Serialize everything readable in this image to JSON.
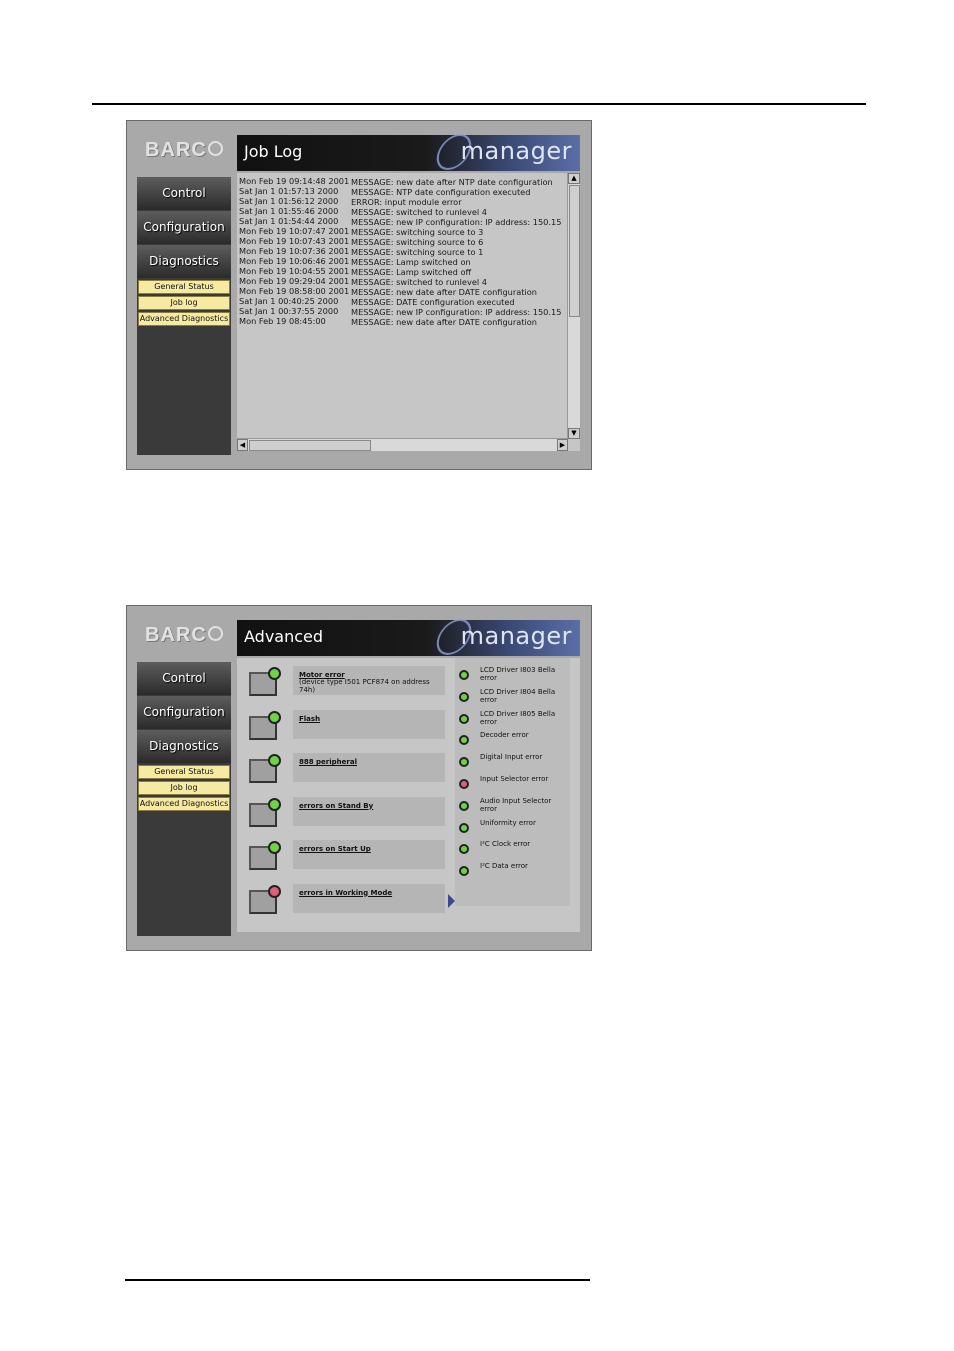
{
  "brand": {
    "logo": "BARC",
    "product": "manager"
  },
  "sidebar": {
    "nav": [
      "Control",
      "Configuration",
      "Diagnostics"
    ],
    "subnav": [
      "General Status",
      "Job log",
      "Advanced Diagnostics"
    ]
  },
  "joblog": {
    "title": "Job Log",
    "rows": [
      {
        "date": "Mon Feb 19 09:14:48 2001",
        "msg": "MESSAGE: new date after NTP date configuration"
      },
      {
        "date": "Sat Jan 1 01:57:13 2000",
        "msg": "MESSAGE: NTP date configuration executed"
      },
      {
        "date": "Sat Jan 1 01:56:12 2000",
        "msg": "ERROR: input module error"
      },
      {
        "date": "Sat Jan 1 01:55:46 2000",
        "msg": "MESSAGE: switched to runlevel 4"
      },
      {
        "date": "Sat Jan 1 01:54:44 2000",
        "msg": "MESSAGE: new IP configuration: IP address: 150.15"
      },
      {
        "date": "Mon Feb 19 10:07:47 2001",
        "msg": "MESSAGE: switching source to 3"
      },
      {
        "date": "Mon Feb 19 10:07:43 2001",
        "msg": "MESSAGE: switching source to 6"
      },
      {
        "date": "Mon Feb 19 10:07:36 2001",
        "msg": "MESSAGE: switching source to 1"
      },
      {
        "date": "Mon Feb 19 10:06:46 2001",
        "msg": "MESSAGE: Lamp switched on"
      },
      {
        "date": "Mon Feb 19 10:04:55 2001",
        "msg": "MESSAGE: Lamp switched off"
      },
      {
        "date": "Mon Feb 19 09:29:04 2001",
        "msg": "MESSAGE: switched to runlevel 4"
      },
      {
        "date": "Mon Feb 19 08:58:00 2001",
        "msg": "MESSAGE: new date after DATE configuration"
      },
      {
        "date": "Sat Jan 1 00:40:25 2000",
        "msg": "MESSAGE: DATE configuration executed"
      },
      {
        "date": "Sat Jan 1 00:37:55 2000",
        "msg": "MESSAGE: new IP configuration: IP address: 150.15"
      },
      {
        "date": "Mon Feb 19 08:45:00",
        "msg": "MESSAGE: new date after DATE configuration"
      }
    ]
  },
  "advanced": {
    "title": "Advanced",
    "items": [
      {
        "label": "Motor error",
        "sub": "(device type I501 PCF874 on address 74h)",
        "led": "#6fd34a"
      },
      {
        "label": "Flash",
        "sub": "",
        "led": "#6fd34a"
      },
      {
        "label": "888 peripheral",
        "sub": "",
        "led": "#6fd34a"
      },
      {
        "label": "errors on Stand By",
        "sub": "",
        "led": "#6fd34a"
      },
      {
        "label": "errors on Start Up",
        "sub": "",
        "led": "#6fd34a"
      },
      {
        "label": "errors in Working Mode",
        "sub": "",
        "led": "#e0607a"
      }
    ],
    "errors": [
      {
        "label": "LCD Driver I803 Bella error",
        "led": "#6fd34a"
      },
      {
        "label": "LCD Driver I804 Bella error",
        "led": "#6fd34a"
      },
      {
        "label": "LCD Driver I805 Bella error",
        "led": "#6fd34a"
      },
      {
        "label": "Decoder error",
        "led": "#6fd34a"
      },
      {
        "label": "Digital Input error",
        "led": "#6fd34a"
      },
      {
        "label": "Input Selector error",
        "led": "#e0607a"
      },
      {
        "label": "Audio Input Selector error",
        "led": "#6fd34a"
      },
      {
        "label": "Uniformity error",
        "led": "#6fd34a"
      },
      {
        "label": "I²C Clock error",
        "led": "#6fd34a"
      },
      {
        "label": "I²C Data error",
        "led": "#6fd34a"
      }
    ]
  }
}
